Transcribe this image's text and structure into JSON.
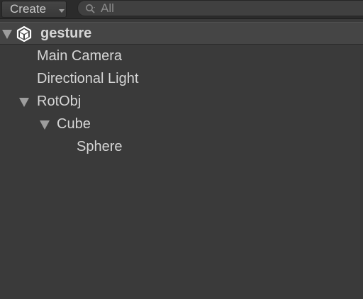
{
  "toolbar": {
    "create_label": "Create",
    "search_placeholder": "All"
  },
  "hierarchy": {
    "scene_name": "gesture",
    "items": [
      {
        "label": "Main Camera"
      },
      {
        "label": "Directional Light"
      },
      {
        "label": "RotObj"
      },
      {
        "label": "Cube"
      },
      {
        "label": "Sphere"
      }
    ]
  },
  "icons": {
    "create_dropdown": "chevron-down-icon",
    "search": "search-icon",
    "scene": "unity-logo-icon",
    "expand": "triangle-down-icon"
  }
}
